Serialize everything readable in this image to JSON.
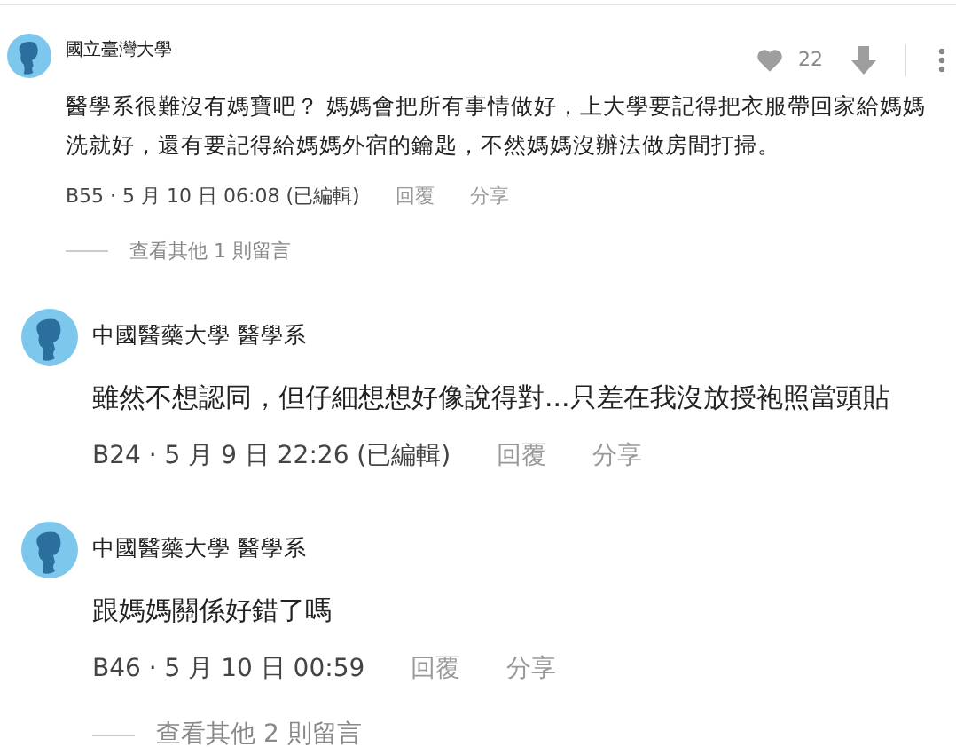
{
  "comments": [
    {
      "kind": "compact",
      "author": "國立臺灣大學",
      "likes": "22",
      "body": "醫學系很難沒有媽寶吧？ 媽媽會把所有事情做好，上大學要記得把衣服帶回家給媽媽洗就好，還有要記得給媽媽外宿的鑰匙，不然媽媽沒辦法做房間打掃。",
      "meta": "B55 · 5 月 10 日 06:08 (已編輯)",
      "reply": "回覆",
      "share": "分享",
      "more_replies": "查看其他 1 則留言"
    },
    {
      "kind": "regular",
      "author": "中國醫藥大學 醫學系",
      "body": "雖然不想認同，但仔細想想好像說得對...只差在我沒放授袍照當頭貼",
      "meta": "B24 · 5 月 9 日 22:26 (已編輯)",
      "reply": "回覆",
      "share": "分享"
    },
    {
      "kind": "regular",
      "author": "中國醫藥大學 醫學系",
      "body": "跟媽媽關係好錯了嗎",
      "meta": "B46 · 5 月 10 日 00:59",
      "reply": "回覆",
      "share": "分享",
      "more_replies": "查看其他 2 則留言"
    }
  ]
}
